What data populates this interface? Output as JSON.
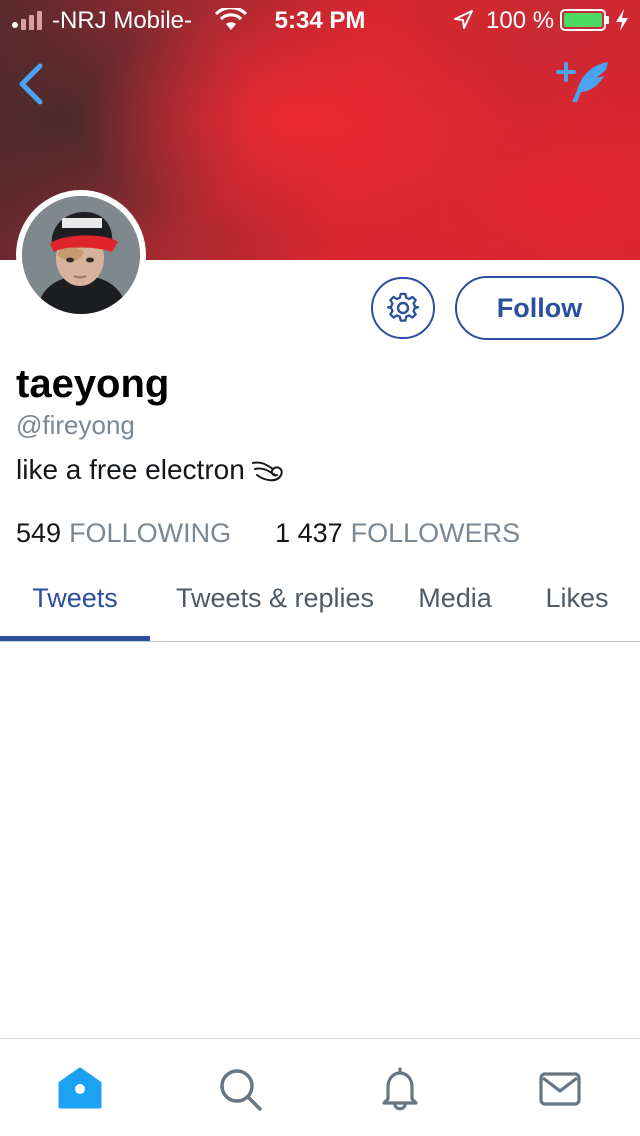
{
  "status_bar": {
    "carrier": "-NRJ Mobile-",
    "time": "5:34 PM",
    "battery_percent": "100 %",
    "icons": [
      "signal-icon",
      "wifi-icon",
      "location-icon",
      "battery-icon",
      "charging-icon"
    ]
  },
  "header": {
    "back_icon": "chevron-left-icon",
    "compose_icon": "compose-tweet-icon"
  },
  "profile": {
    "display_name": "taeyong",
    "handle": "@fireyong",
    "bio": "like a free electron",
    "bio_emoji": "swirl-icon",
    "following_count": "549",
    "following_label": "FOLLOWING",
    "followers_count": "1 437",
    "followers_label": "FOLLOWERS"
  },
  "actions": {
    "settings_icon": "gear-icon",
    "follow_label": "Follow"
  },
  "tabs": [
    {
      "label": "Tweets",
      "active": true
    },
    {
      "label": "Tweets & replies",
      "active": false
    },
    {
      "label": "Media",
      "active": false
    },
    {
      "label": "Likes",
      "active": false
    }
  ],
  "bottom_nav": [
    "home-icon",
    "search-icon",
    "notifications-icon",
    "messages-icon"
  ],
  "colors": {
    "accent": "#2b4f9d",
    "twitter_blue": "#1da1f2",
    "muted_text": "#7b8792",
    "banner_red": "#d8272f"
  }
}
